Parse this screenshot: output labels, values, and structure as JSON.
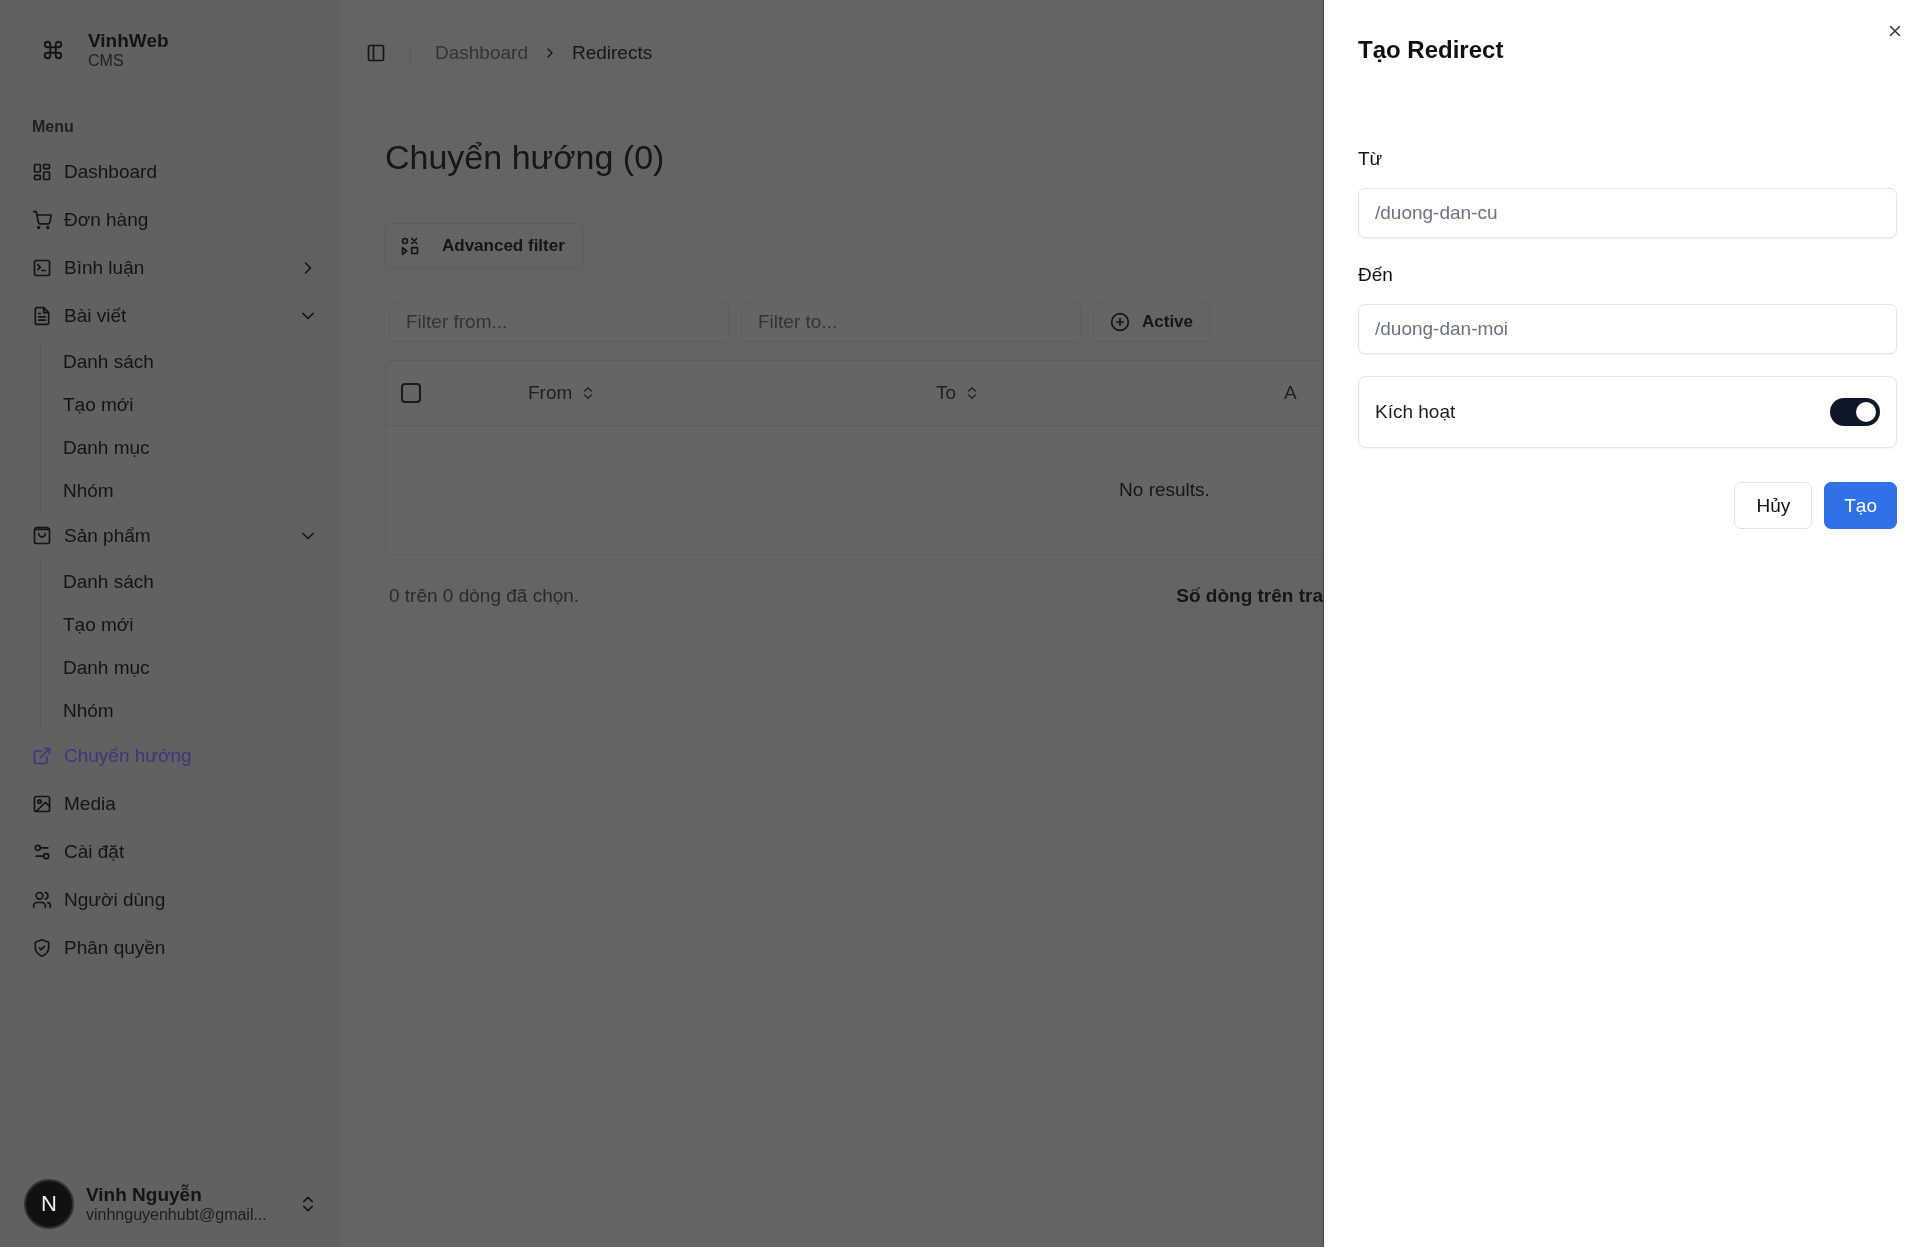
{
  "brand": {
    "name": "VinhWeb",
    "subtitle": "CMS"
  },
  "sidebar": {
    "menu_label": "Menu",
    "items": [
      {
        "label": "Dashboard",
        "selected": false
      },
      {
        "label": "Đơn hàng",
        "selected": false
      },
      {
        "label": "Bình luận",
        "selected": false,
        "expanded": false
      },
      {
        "label": "Bài viết",
        "selected": false,
        "expanded": true,
        "children": [
          {
            "label": "Danh sách"
          },
          {
            "label": "Tạo mới"
          },
          {
            "label": "Danh mục"
          },
          {
            "label": "Nhóm"
          }
        ]
      },
      {
        "label": "Sản phẩm",
        "selected": false,
        "expanded": true,
        "children": [
          {
            "label": "Danh sách"
          },
          {
            "label": "Tạo mới"
          },
          {
            "label": "Danh mục"
          },
          {
            "label": "Nhóm"
          }
        ]
      },
      {
        "label": "Chuyển hướng",
        "selected": true
      },
      {
        "label": "Media",
        "selected": false
      },
      {
        "label": "Cài đặt",
        "selected": false
      },
      {
        "label": "Người dùng",
        "selected": false
      },
      {
        "label": "Phân quyền",
        "selected": false
      }
    ]
  },
  "user": {
    "initial": "N",
    "name": "Vinh Nguyễn",
    "email": "vinhnguyenhubt@gmail..."
  },
  "breadcrumbs": [
    "Dashboard",
    "Redirects"
  ],
  "page_title": "Chuyển hướng (0)",
  "advanced_filter": "Advanced filter",
  "filters": [
    {
      "placeholder": "Filter from..."
    },
    {
      "placeholder": "Filter to..."
    }
  ],
  "active_filter": "Active",
  "table": {
    "select_all_checked": false,
    "columns": [
      "From",
      "To",
      "A"
    ],
    "empty_text": "No results."
  },
  "selection_text": "0 trên 0 dòng đã chọn.",
  "rows_per_page_label": "Số dòng trên tra",
  "panel": {
    "title": "Tạo Redirect",
    "fields": [
      {
        "label": "Từ",
        "placeholder": "/duong-dan-cu"
      },
      {
        "label": "Đến",
        "placeholder": "/duong-dan-moi"
      }
    ],
    "toggle": {
      "label": "Kích hoạt",
      "on": true
    },
    "buttons": [
      {
        "label": "Hủy",
        "kind": "secondary"
      },
      {
        "label": "Tạo",
        "kind": "primary"
      }
    ]
  }
}
